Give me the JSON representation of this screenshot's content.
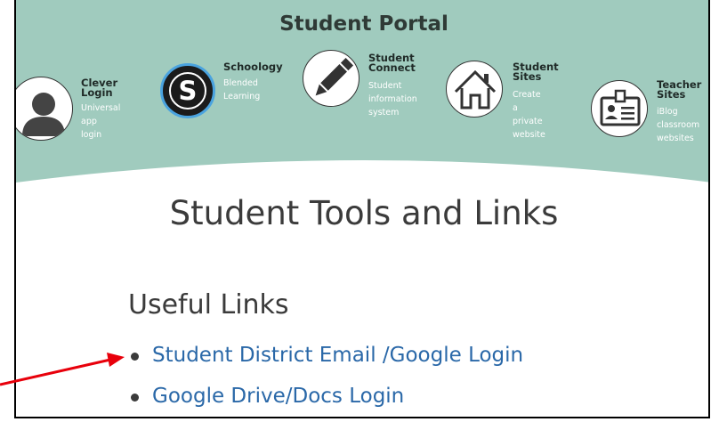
{
  "banner": {
    "title": "Student Portal",
    "background_color": "#a0cbbe",
    "tiles": [
      {
        "id": "clever",
        "title": "Clever\nLogin",
        "desc": "Universal app\nlogin",
        "icon": "user-avatar-icon"
      },
      {
        "id": "schoology",
        "title": "Schoology",
        "desc": "Blended\nLearning",
        "icon": "schoology-s-icon"
      },
      {
        "id": "connect",
        "title": "Student\nConnect",
        "desc": "Student\ninformation\nsystem",
        "icon": "pencil-icon"
      },
      {
        "id": "sites",
        "title": "Student\nSites",
        "desc": "Create a\nprivate\nwebsite",
        "icon": "house-icon"
      },
      {
        "id": "teacher",
        "title": "Teacher\nSites",
        "desc": "iBlog\nclassroom\nwebsites",
        "icon": "id-badge-icon"
      }
    ]
  },
  "main": {
    "heading": "Student Tools and Links",
    "subheading": "Useful Links",
    "links": [
      {
        "label": "Student District Email /Google Login"
      },
      {
        "label": "Google Drive/Docs Login"
      }
    ],
    "link_color": "#2a68a8"
  },
  "annotation": {
    "arrow_color": "#e8000b"
  }
}
